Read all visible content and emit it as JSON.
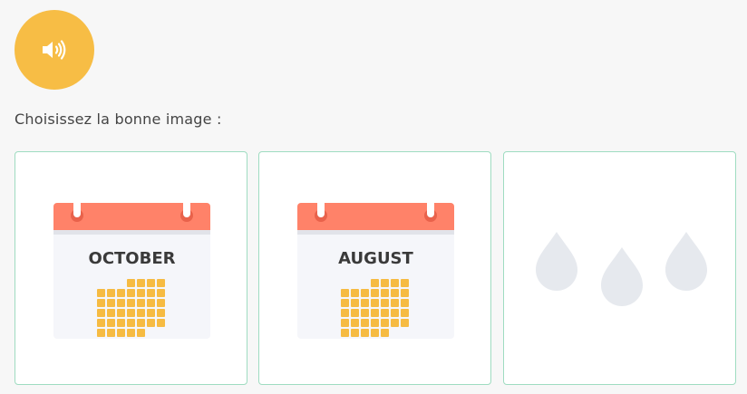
{
  "audio": {
    "icon": "speaker-icon",
    "color": "#f7bd45"
  },
  "prompt": "Choisissez la bonne image :",
  "choices": [
    {
      "type": "calendar",
      "month": "OCTOBER"
    },
    {
      "type": "calendar",
      "month": "AUGUST"
    },
    {
      "type": "raindrops"
    }
  ],
  "colors": {
    "accent": "#f7bd45",
    "calendar_header": "#ff8269",
    "calendar_grid": "#f6bb42",
    "card_border": "#9fdcc1",
    "raindrop": "#e6e9ee"
  }
}
